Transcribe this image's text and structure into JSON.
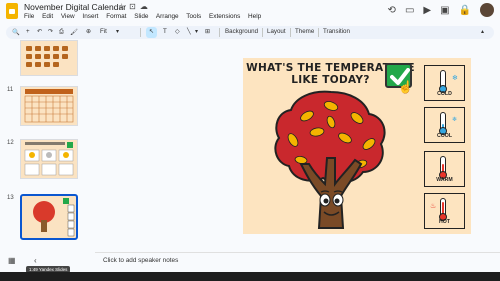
{
  "app": {
    "title": "November Digital Calendar",
    "menu": [
      "File",
      "Edit",
      "View",
      "Insert",
      "Format",
      "Slide",
      "Arrange",
      "Tools",
      "Extensions",
      "Help"
    ]
  },
  "toolbar": {
    "zoom": "Fit",
    "background": "Background",
    "layout": "Layout",
    "theme": "Theme",
    "transition": "Transition"
  },
  "slides_panel": {
    "numbers": [
      "11",
      "12",
      "13"
    ],
    "tooltip": "1:49 Yandex Slides"
  },
  "slide": {
    "title_line1": "WHAT'S THE TEMPERATURE",
    "title_line2": "LIKE TODAY?",
    "options": [
      {
        "label": "COLD",
        "level": 0.2,
        "color": "#35a7e0"
      },
      {
        "label": "COOL",
        "level": 0.4,
        "color": "#35a7e0"
      },
      {
        "label": "WARM",
        "level": 0.65,
        "color": "#e8352b"
      },
      {
        "label": "HOT",
        "level": 0.9,
        "color": "#e8352b"
      }
    ]
  },
  "notes": {
    "placeholder": "Click to add speaker notes"
  }
}
